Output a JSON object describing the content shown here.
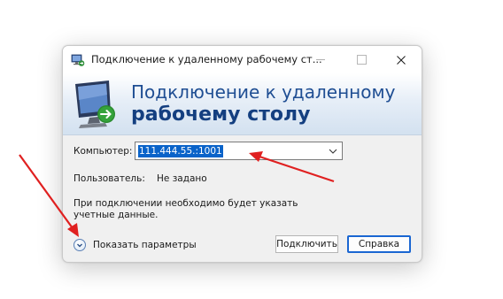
{
  "window": {
    "title": "Подключение к удаленному рабочему ст...",
    "controls": {
      "minimize_icon": "minimize-icon",
      "maximize_icon": "maximize-icon",
      "close_icon": "close-icon"
    }
  },
  "banner": {
    "line1": "Подключение к удаленному",
    "line2": "рабочему столу",
    "icon": "remote-desktop-monitor-icon"
  },
  "form": {
    "computer_label": "Компьютер:",
    "computer_value": "111.444.55.:1001",
    "user_label": "Пользователь:",
    "user_value": "Не задано",
    "note": "При подключении необходимо будет указать учетные данные."
  },
  "footer": {
    "show_options": "Показать параметры",
    "connect": "Подключить",
    "help": "Справка"
  },
  "colors": {
    "accent": "#1a66d2",
    "selection": "#0a63c9",
    "banner_text": "#1f4e93",
    "annotation_arrow": "#e02020"
  }
}
